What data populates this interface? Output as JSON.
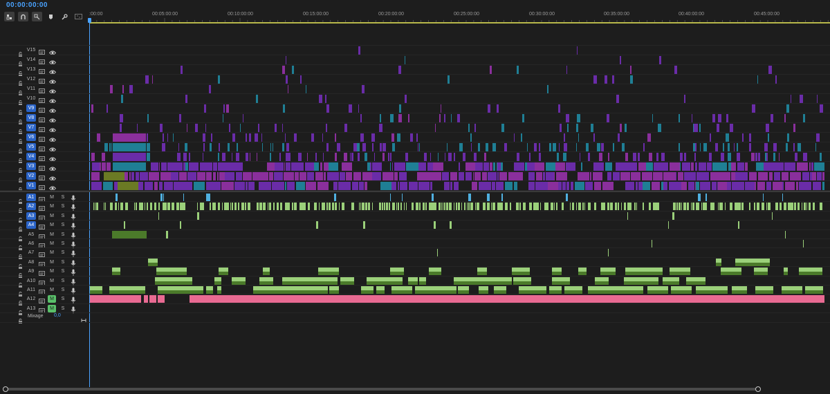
{
  "timecode": "00:00:00:00",
  "toolbar": {
    "tools": [
      "nest-icon",
      "snap-icon",
      "linked-selection-icon",
      "marker-icon",
      "wrench-icon",
      "captions-icon"
    ]
  },
  "ruler": {
    "labels": [
      ":00:00",
      "00:05:00:00",
      "00:10:00:00",
      "00:15:00:00",
      "00:20:00:00",
      "00:25:00:00",
      "00:30:00:00",
      "00:35:00:00",
      "00:40:00:00",
      "00:45:00:00"
    ]
  },
  "video_tracks": [
    {
      "name": "V15",
      "targeted": false
    },
    {
      "name": "V14",
      "targeted": false
    },
    {
      "name": "V13",
      "targeted": false
    },
    {
      "name": "V12",
      "targeted": false
    },
    {
      "name": "V11",
      "targeted": false
    },
    {
      "name": "V10",
      "targeted": false
    },
    {
      "name": "V9",
      "targeted": true
    },
    {
      "name": "V8",
      "targeted": true
    },
    {
      "name": "V7",
      "targeted": true
    },
    {
      "name": "V6",
      "targeted": true
    },
    {
      "name": "V5",
      "targeted": true
    },
    {
      "name": "V4",
      "targeted": true
    },
    {
      "name": "V3",
      "targeted": true
    },
    {
      "name": "V2",
      "targeted": true
    },
    {
      "name": "V1",
      "targeted": true
    }
  ],
  "audio_tracks": [
    {
      "name": "A1",
      "targeted": true,
      "muted": false
    },
    {
      "name": "A2",
      "targeted": true,
      "muted": false
    },
    {
      "name": "A3",
      "targeted": true,
      "muted": false
    },
    {
      "name": "A4",
      "targeted": true,
      "muted": false
    },
    {
      "name": "A5",
      "targeted": false,
      "muted": false
    },
    {
      "name": "A6",
      "targeted": false,
      "muted": false
    },
    {
      "name": "A7",
      "targeted": false,
      "muted": false
    },
    {
      "name": "A8",
      "targeted": false,
      "muted": false
    },
    {
      "name": "A9",
      "targeted": false,
      "muted": false
    },
    {
      "name": "A10",
      "targeted": false,
      "muted": false
    },
    {
      "name": "A11",
      "targeted": false,
      "muted": false
    },
    {
      "name": "A12",
      "targeted": false,
      "muted": true
    },
    {
      "name": "A13",
      "targeted": false,
      "muted": true
    }
  ],
  "track_buttons": {
    "mute": "M",
    "solo": "S"
  },
  "mix": {
    "label": "Mixage",
    "value": "0,0"
  },
  "colors": {
    "accent": "#4aa3ff",
    "video_purple": "#6a2ca8",
    "video_magenta": "#8a2f9c",
    "video_teal": "#1f7f95",
    "video_olive": "#6b7a24",
    "audio_green": "#9bd07a",
    "audio_dark_green": "#4b7a2a",
    "audio_pink": "#e86a92",
    "audio_blue": "#4fb0e0"
  }
}
